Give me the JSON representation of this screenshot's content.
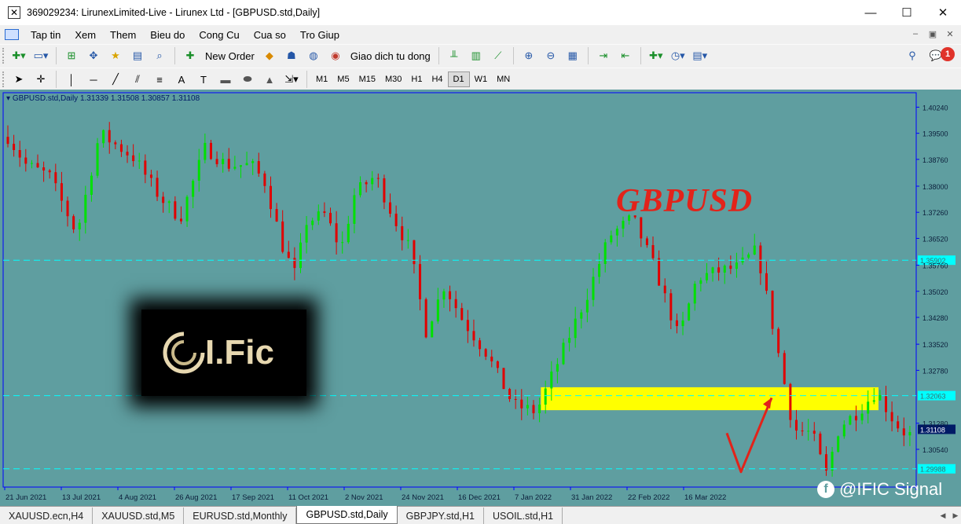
{
  "window": {
    "title": "369029234: LirunexLimited-Live - Lirunex Ltd - [GBPUSD.std,Daily]",
    "app_icon": "close-box-icon",
    "controls": [
      "—",
      "☐",
      "✕"
    ]
  },
  "menu": {
    "items": [
      "Tap tin",
      "Xem",
      "Them",
      "Bieu do",
      "Cong Cu",
      "Cua so",
      "Tro Giup"
    ],
    "mdi_controls": [
      "–",
      "▣",
      "✕"
    ]
  },
  "toolbar": {
    "new_order_label": "New Order",
    "autotrade_label": "Giao dich tu dong",
    "alerts_count": "1"
  },
  "timeframes": {
    "items": [
      "M1",
      "M5",
      "M15",
      "M30",
      "H1",
      "H4",
      "D1",
      "W1",
      "MN"
    ],
    "active": "D1"
  },
  "chart": {
    "header": "GBPUSD.std,Daily  1.31339 1.31508 1.30857 1.31108",
    "symbol_label": "GBPUSD",
    "logo_text": "I.Fic",
    "watermark": "@IFIC Signal",
    "colors": {
      "background": "#5f9ea0",
      "bull": "#00e000",
      "bear": "#e00000",
      "hline": "#00ffff",
      "zone": "#ffff00",
      "arrow": "#e2231a",
      "frame": "#0000ff"
    }
  },
  "chart_data": {
    "type": "candlestick",
    "symbol": "GBPUSD.std",
    "timeframe": "Daily",
    "last_bar": {
      "open": 1.31339,
      "high": 1.31508,
      "low": 1.30857,
      "close": 1.31108
    },
    "ylim": [
      1.2947,
      1.4065
    ],
    "y_ticks": [
      1.4024,
      1.395,
      1.3876,
      1.38,
      1.3726,
      1.3652,
      1.3576,
      1.3502,
      1.3428,
      1.3352,
      1.3278,
      1.3128,
      1.3054
    ],
    "y_tick_labels": [
      "1.40240",
      "1.39500",
      "1.38760",
      "1.38000",
      "1.37260",
      "1.36520",
      "1.35760",
      "1.35020",
      "1.34280",
      "1.33520",
      "1.32780",
      "1.31280",
      "1.30540"
    ],
    "x_tick_labels": [
      "21 Jun 2021",
      "13 Jul 2021",
      "4 Aug 2021",
      "26 Aug 2021",
      "17 Sep 2021",
      "11 Oct 2021",
      "2 Nov 2021",
      "24 Nov 2021",
      "16 Dec 2021",
      "7 Jan 2022",
      "31 Jan 2022",
      "22 Feb 2022",
      "16 Mar 2022"
    ],
    "horizontal_lines": [
      {
        "price": 1.35902,
        "label": "1.35902"
      },
      {
        "price": 1.32063,
        "label": "1.32063"
      },
      {
        "price": 1.29988,
        "label": "1.29988"
      }
    ],
    "current_price": {
      "price": 1.31108,
      "label": "1.31108"
    },
    "support_zone": {
      "low": 1.3165,
      "high": 1.323,
      "from_date": "16 Dec 2021"
    },
    "projection_arrow": [
      {
        "date": "24 Mar 2022",
        "price": 1.31
      },
      {
        "date": "29 Mar 2022",
        "price": 1.299
      },
      {
        "date": "4 Apr 2022",
        "price": 1.32
      }
    ]
  },
  "tabs": {
    "items": [
      "XAUUSD.ecn,H4",
      "XAUUSD.std,M5",
      "EURUSD.std,Monthly",
      "GBPUSD.std,Daily",
      "GBPJPY.std,H1",
      "USOIL.std,H1"
    ],
    "active": "GBPUSD.std,Daily"
  }
}
